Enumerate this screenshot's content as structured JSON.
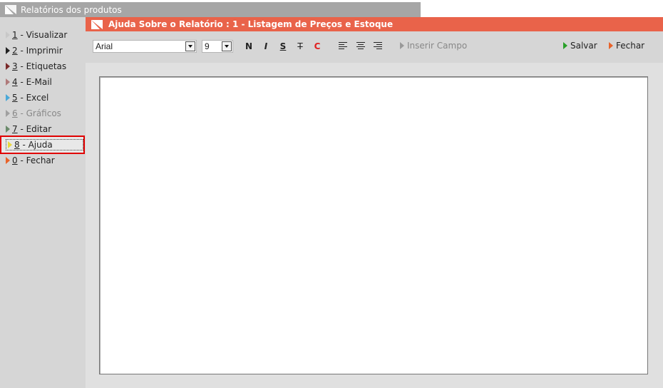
{
  "window": {
    "title": "Relatórios dos produtos"
  },
  "sidebar": {
    "items": [
      {
        "key": "1",
        "label": " - Visualizar",
        "arrow_color": "#c8c8c8",
        "disabled": false
      },
      {
        "key": "2",
        "label": " - Imprimir",
        "arrow_color": "#222222",
        "disabled": false
      },
      {
        "key": "3",
        "label": " - Etiquetas",
        "arrow_color": "#7a2a2a",
        "disabled": false
      },
      {
        "key": "4",
        "label": " - E-Mail",
        "arrow_color": "#b07a7a",
        "disabled": false
      },
      {
        "key": "5",
        "label": " - Excel",
        "arrow_color": "#4aa8d8",
        "disabled": false
      },
      {
        "key": "6",
        "label": " - Gráficos",
        "arrow_color": "#a0a0a0",
        "disabled": true
      },
      {
        "key": "7",
        "label": " - Editar",
        "arrow_color": "#6a8a6a",
        "disabled": false
      },
      {
        "key": "8",
        "label": " - Ajuda",
        "arrow_color": "#e8d840",
        "disabled": false,
        "active": true
      },
      {
        "key": "0",
        "label": " - Fechar",
        "arrow_color": "#e8632a",
        "disabled": false
      }
    ]
  },
  "panel": {
    "title": "Ajuda Sobre o Relatório : 1 - Listagem de Preços e Estoque",
    "header_color": "#e9634a"
  },
  "toolbar": {
    "font": "Arial",
    "size": "9",
    "bold": "N",
    "italic": "I",
    "underline": "S",
    "strike": "T",
    "color": "C",
    "insert_field": "Inserir Campo",
    "save": "Salvar",
    "close": "Fechar"
  }
}
